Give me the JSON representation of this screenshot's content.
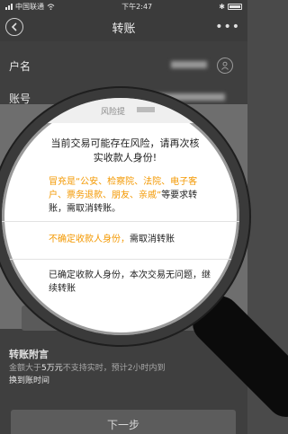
{
  "status_bar": {
    "carrier": "中国联通",
    "time": "下午2:47"
  },
  "nav": {
    "title": "转账",
    "more": "•••"
  },
  "form": {
    "name_label": "户名",
    "account_label": "账号",
    "account_prefix": "6",
    "dialog_partial_title": "风险提"
  },
  "risk_dialog": {
    "heading": "当前交易可能存在风险，请再次核实收款人身份!",
    "option1": {
      "prefix": "冒充是",
      "entities": "“公安、检察院、法院、电子客户、票务退款、朋友、亲戚”",
      "suffix": "等要求转账，需取消转账。"
    },
    "option2": {
      "highlight": "不确定收款人身份，",
      "suffix": "需取消转账"
    },
    "option3": "已确定收款人身份，本次交易无问题，继续转账"
  },
  "attachment": {
    "title": "转账附言",
    "note_prefix": "金额大于",
    "note_amount": "5万元",
    "note_middle": "不支持实时，预计2小时内到",
    "note_end": "换到账时间"
  },
  "next_button": "下一步",
  "colors": {
    "accent_orange": "#f39800",
    "lens_rim": "#3a3a3a",
    "handle": "#0b0b0b"
  },
  "icons": [
    "back-arrow-icon",
    "more-dots-icon",
    "person-icon",
    "scam-caller-icon",
    "unknown-mask-icon",
    "wifi-icon",
    "battery-icon"
  ]
}
